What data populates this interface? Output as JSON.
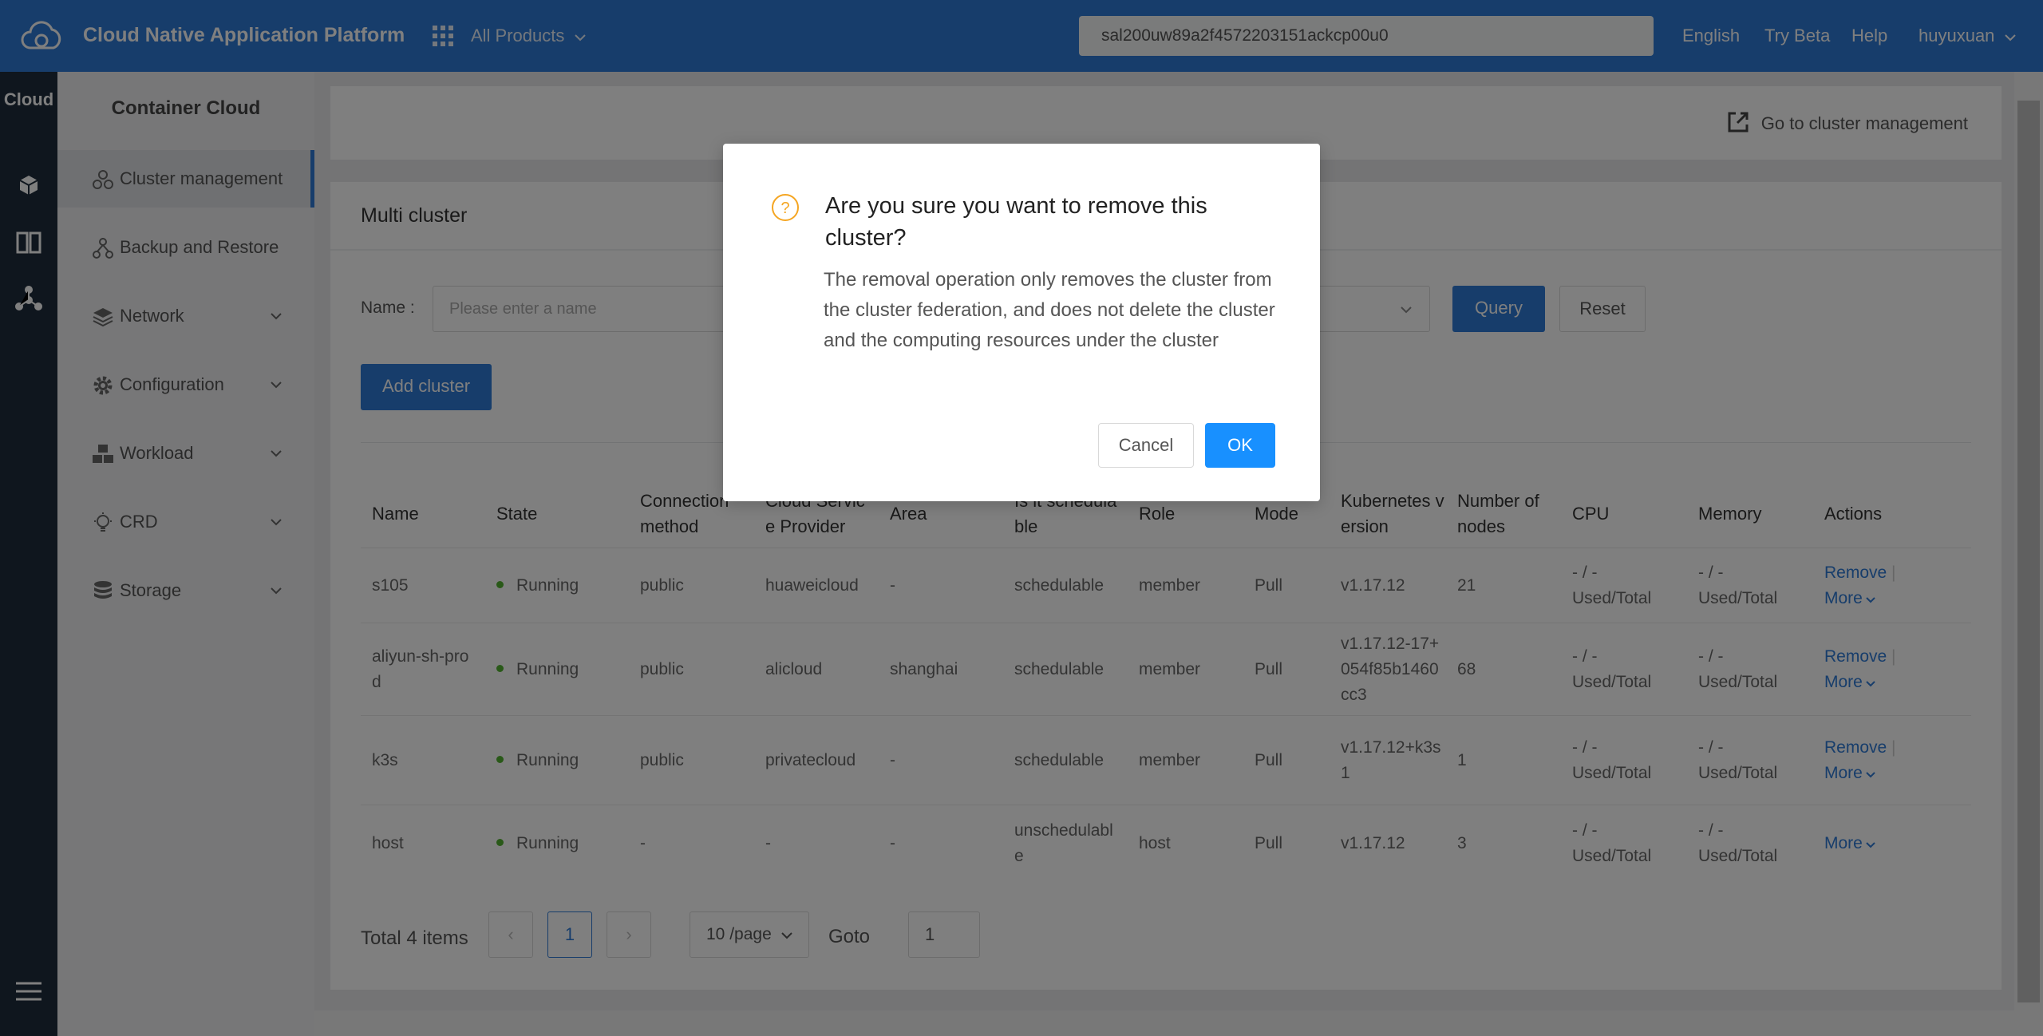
{
  "topbar": {
    "brand": "Cloud Native Application Platform",
    "products": "All Products",
    "search_value": "sal200uw89a2f4572203151ackcp00u0",
    "language": "English",
    "try_beta": "Try Beta",
    "help": "Help",
    "user": "huyuxuan"
  },
  "rail": {
    "title": "Cloud"
  },
  "sidemenu": {
    "title": "Container Cloud",
    "items": [
      {
        "label": "Cluster management",
        "icon": "cluster-icon",
        "active": true
      },
      {
        "label": "Backup and Restore",
        "icon": "backup-icon"
      },
      {
        "label": "Network",
        "icon": "network-icon"
      },
      {
        "label": "Configuration",
        "icon": "gear-icon"
      },
      {
        "label": "Workload",
        "icon": "workload-icon"
      },
      {
        "label": "CRD",
        "icon": "lightbulb-icon"
      },
      {
        "label": "Storage",
        "icon": "database-icon"
      }
    ]
  },
  "content": {
    "goto_mgmt": "Go to cluster management",
    "section_title": "Multi cluster",
    "filter_label": "Name :",
    "name_placeholder": "Please enter a name",
    "query": "Query",
    "reset": "Reset",
    "add_cluster": "Add cluster"
  },
  "table": {
    "headers": [
      "Name",
      "State",
      "Connection method",
      "Cloud Service Provider",
      "Area",
      "Is it schedulable",
      "Role",
      "Mode",
      "Kubernetes version",
      "Number of nodes",
      "CPU",
      "Memory",
      "Actions"
    ],
    "header_lines": [
      [
        "Name"
      ],
      [
        "State"
      ],
      [
        "Connection",
        "method"
      ],
      [
        "Cloud Servic",
        "e Provider"
      ],
      [
        "Area"
      ],
      [
        "Is it schedula",
        "ble"
      ],
      [
        "Role"
      ],
      [
        "Mode"
      ],
      [
        "Kubernetes v",
        "ersion"
      ],
      [
        "Number of",
        "nodes"
      ],
      [
        "CPU"
      ],
      [
        "Memory"
      ],
      [
        "Actions"
      ]
    ],
    "rows": [
      {
        "name": [
          "s105"
        ],
        "state": "Running",
        "conn": "public",
        "provider": "huaweicloud",
        "area": "-",
        "sched": [
          "schedulable"
        ],
        "role": "member",
        "mode": "Pull",
        "k8s": [
          "v1.17.12"
        ],
        "nodes": "21",
        "cpu": [
          "- / -",
          "Used/Total"
        ],
        "mem": [
          "- / -",
          "Used/Total"
        ],
        "remove": "Remove",
        "more": "More"
      },
      {
        "name": [
          "aliyun-sh-pro",
          "d"
        ],
        "state": "Running",
        "conn": "public",
        "provider": "alicloud",
        "area": "shanghai",
        "sched": [
          "schedulable"
        ],
        "role": "member",
        "mode": "Pull",
        "k8s": [
          "v1.17.12-17+",
          "054f85b1460",
          "cc3"
        ],
        "nodes": "68",
        "cpu": [
          "- / -",
          "Used/Total"
        ],
        "mem": [
          "- / -",
          "Used/Total"
        ],
        "remove": "Remove",
        "more": "More"
      },
      {
        "name": [
          "k3s"
        ],
        "state": "Running",
        "conn": "public",
        "provider": "privatecloud",
        "area": "-",
        "sched": [
          "schedulable"
        ],
        "role": "member",
        "mode": "Pull",
        "k8s": [
          "v1.17.12+k3s",
          "1"
        ],
        "nodes": "1",
        "cpu": [
          "- / -",
          "Used/Total"
        ],
        "mem": [
          "- / -",
          "Used/Total"
        ],
        "remove": "Remove",
        "more": "More"
      },
      {
        "name": [
          "host"
        ],
        "state": "Running",
        "conn": "-",
        "provider": "-",
        "area": "-",
        "sched": [
          "unschedulabl",
          "e"
        ],
        "role": "host",
        "mode": "Pull",
        "k8s": [
          "v1.17.12"
        ],
        "nodes": "3",
        "cpu": [
          "- / -",
          "Used/Total"
        ],
        "mem": [
          "- / -",
          "Used/Total"
        ],
        "remove": "",
        "more": "More"
      }
    ]
  },
  "pager": {
    "total": "Total 4 items",
    "current": "1",
    "page_size": "10 /page",
    "goto_label": "Goto",
    "goto_value": "1"
  },
  "modal": {
    "title": "Are you sure you want to remove this cluster?",
    "body": "The removal operation only removes the cluster from the cluster federation, and does not delete the cluster and the computing resources under the cluster",
    "cancel": "Cancel",
    "ok": "OK"
  },
  "colors": {
    "primary": "#2f7bd6",
    "ok_button": "#1890ff",
    "running": "#52b330",
    "warning": "#f5a623"
  }
}
